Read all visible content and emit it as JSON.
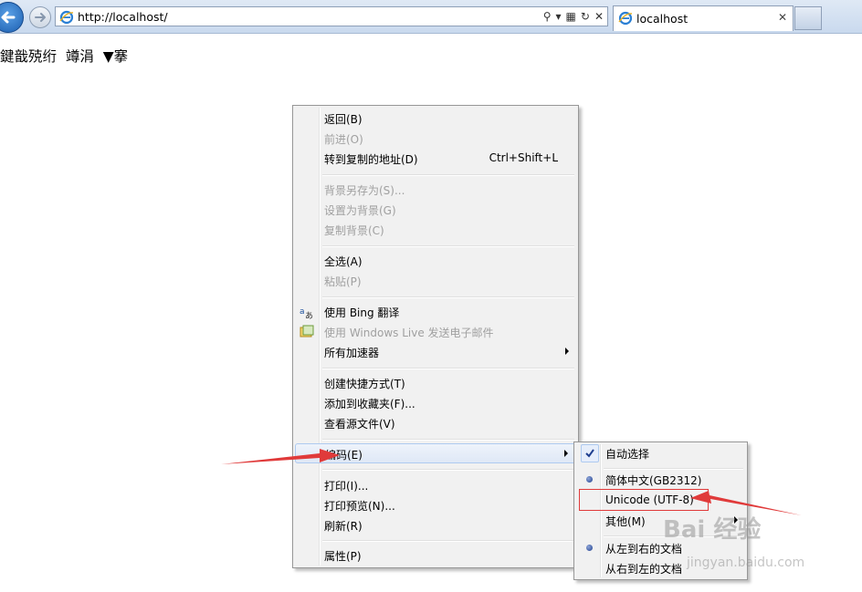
{
  "browser": {
    "address": "http://localhost/",
    "tab_title": "localhost"
  },
  "page": {
    "text": "鍵戠殑绗  竴涓  ▼搴"
  },
  "context_menu": {
    "items": [
      {
        "label": "返回(B)",
        "disabled": false
      },
      {
        "label": "前进(O)",
        "disabled": true
      },
      {
        "label": "转到复制的地址(D)",
        "shortcut": "Ctrl+Shift+L",
        "disabled": false
      },
      {
        "label": "背景另存为(S)...",
        "disabled": true
      },
      {
        "label": "设置为背景(G)",
        "disabled": true
      },
      {
        "label": "复制背景(C)",
        "disabled": true
      },
      {
        "label": "全选(A)",
        "disabled": false
      },
      {
        "label": "粘贴(P)",
        "disabled": true
      },
      {
        "label": "使用 Bing 翻译",
        "icon": "translate-icon",
        "disabled": false
      },
      {
        "label": "使用 Windows Live 发送电子邮件",
        "icon": "mail-icon",
        "disabled": true
      },
      {
        "label": "所有加速器",
        "has_submenu": true,
        "disabled": false
      },
      {
        "label": "创建快捷方式(T)",
        "disabled": false
      },
      {
        "label": "添加到收藏夹(F)...",
        "disabled": false
      },
      {
        "label": "查看源文件(V)",
        "disabled": false
      },
      {
        "label": "编码(E)",
        "has_submenu": true,
        "highlighted": true,
        "disabled": false
      },
      {
        "label": "打印(I)...",
        "disabled": false
      },
      {
        "label": "打印预览(N)...",
        "disabled": false
      },
      {
        "label": "刷新(R)",
        "disabled": false
      },
      {
        "label": "属性(P)",
        "disabled": false
      }
    ]
  },
  "encoding_submenu": {
    "items": [
      {
        "label": "自动选择",
        "checked": true
      },
      {
        "label": "简体中文(GB2312)",
        "selected": true
      },
      {
        "label": "Unicode (UTF-8)",
        "annotated": true
      },
      {
        "label": "其他(M)",
        "has_submenu": true
      },
      {
        "label": "从左到右的文档",
        "selected": true
      },
      {
        "label": "从右到左的文档"
      }
    ]
  },
  "watermark": {
    "brand": "Bai 经验",
    "url": "jingyan.baidu.com"
  },
  "colors": {
    "annotation": "#e03a3a",
    "highlight_border": "#aecaf0",
    "chrome": "#c9d9ee"
  }
}
